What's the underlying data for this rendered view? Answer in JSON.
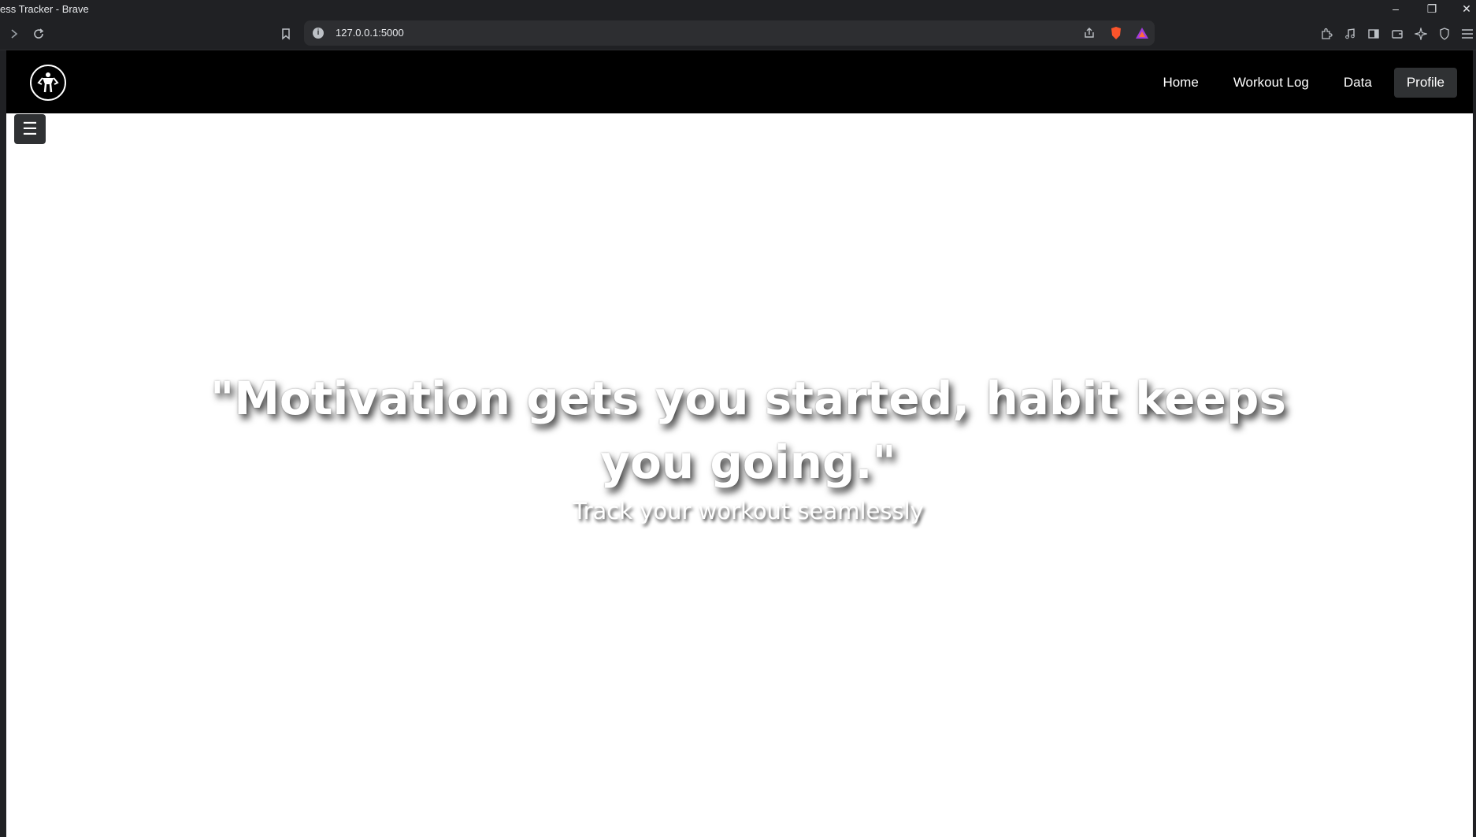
{
  "browser": {
    "window_title": "ess Tracker - Brave",
    "url": "127.0.0.1:5000"
  },
  "navbar": {
    "links": [
      {
        "label": "Home"
      },
      {
        "label": "Workout Log"
      },
      {
        "label": "Data"
      },
      {
        "label": "Profile",
        "active": true
      }
    ],
    "menu_toggle": "☰"
  },
  "hero": {
    "quote": "\"Motivation gets you started, habit keeps you going.\"",
    "tagline": "Track your workout seamlessly"
  },
  "colors": {
    "navbar_bg": "#000000",
    "active_link_bg": "#2f3133",
    "hero_text": "#ffffff"
  }
}
